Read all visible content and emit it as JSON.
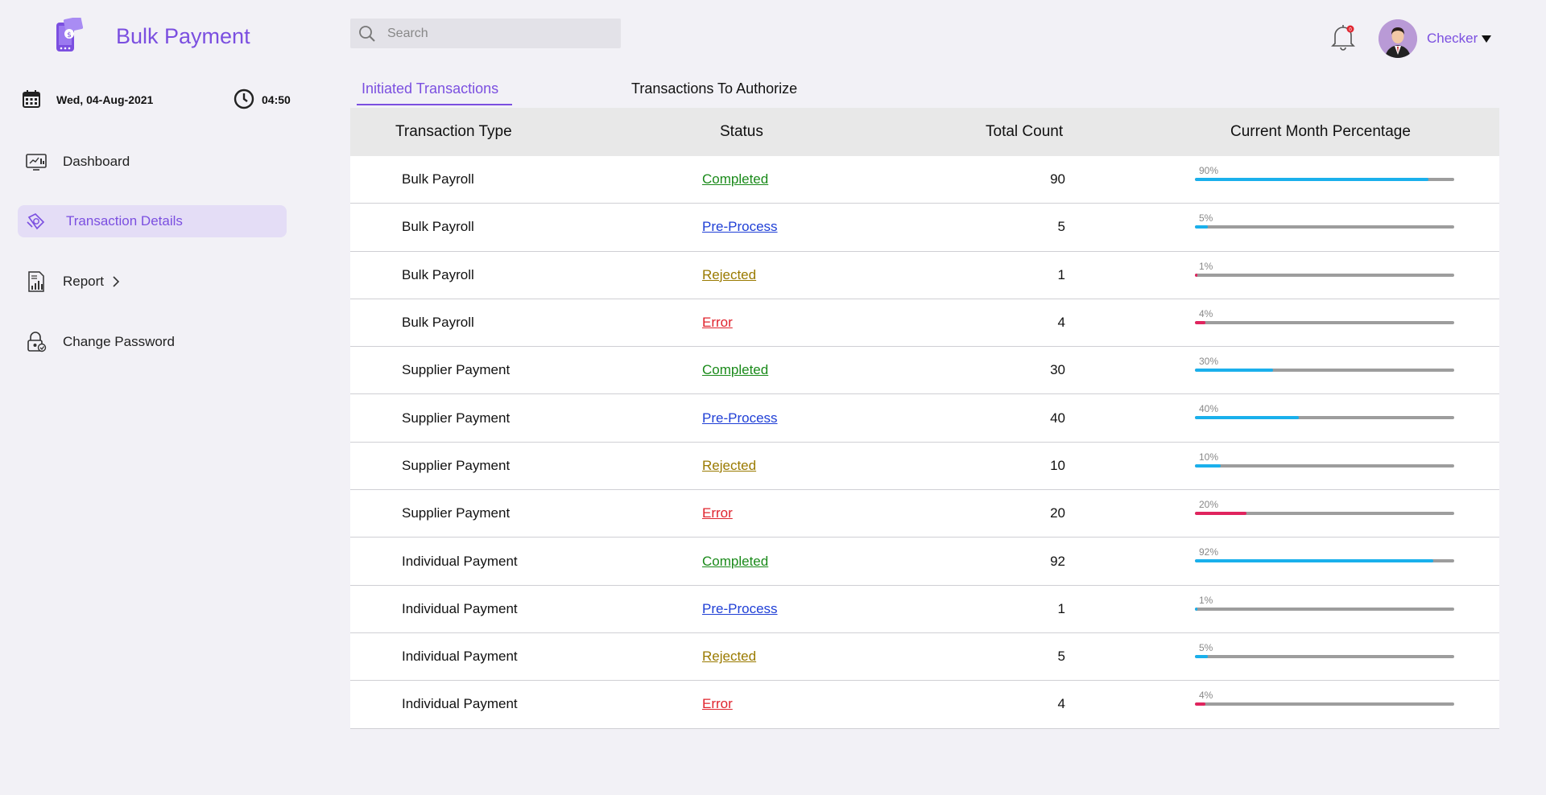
{
  "app": {
    "title": "Bulk Payment"
  },
  "datetime": {
    "date": "Wed, 04-Aug-2021",
    "time": "04:50"
  },
  "sidebar": {
    "items": [
      {
        "label": "Dashboard",
        "icon": "dashboard-monitor-icon"
      },
      {
        "label": "Transaction Details",
        "icon": "transaction-icon",
        "active": true
      },
      {
        "label": "Report",
        "icon": "report-chart-icon"
      },
      {
        "label": "Change Password",
        "icon": "password-lock-icon"
      }
    ]
  },
  "header": {
    "search_placeholder": "Search",
    "notification_count": "0",
    "user_name": "Checker"
  },
  "tabs": [
    {
      "label": "Initiated Transactions",
      "active": true
    },
    {
      "label": "Transactions To Authorize",
      "active": false
    }
  ],
  "table": {
    "columns": [
      "Transaction Type",
      "Status",
      "Total Count",
      "Current Month Percentage"
    ],
    "rows": [
      {
        "type": "Bulk Payroll",
        "status": "Completed",
        "count": "90",
        "pct_label": "90%",
        "pct": 90
      },
      {
        "type": "Bulk Payroll",
        "status": "Pre-Process",
        "count": "5",
        "pct_label": "5%",
        "pct": 5
      },
      {
        "type": "Bulk Payroll",
        "status": "Rejected",
        "count": "1",
        "pct_label": "1%",
        "pct": 1
      },
      {
        "type": "Bulk Payroll",
        "status": "Error",
        "count": "4",
        "pct_label": "4%",
        "pct": 4
      },
      {
        "type": "Supplier Payment",
        "status": "Completed",
        "count": "30",
        "pct_label": "30%",
        "pct": 30
      },
      {
        "type": "Supplier Payment",
        "status": "Pre-Process",
        "count": "40",
        "pct_label": "40%",
        "pct": 40
      },
      {
        "type": "Supplier Payment",
        "status": "Rejected",
        "count": "10",
        "pct_label": "10%",
        "pct": 10
      },
      {
        "type": "Supplier Payment",
        "status": "Error",
        "count": "20",
        "pct_label": "20%",
        "pct": 20
      },
      {
        "type": "Individual Payment",
        "status": "Completed",
        "count": "92",
        "pct_label": "92%",
        "pct": 92
      },
      {
        "type": "Individual Payment",
        "status": "Pre-Process",
        "count": "1",
        "pct_label": "1%",
        "pct": 1
      },
      {
        "type": "Individual Payment",
        "status": "Rejected",
        "count": "5",
        "pct_label": "5%",
        "pct": 5
      },
      {
        "type": "Individual Payment",
        "status": "Error",
        "count": "4",
        "pct_label": "4%",
        "pct": 4
      }
    ]
  },
  "colors": {
    "accent": "#7b4fe0",
    "status_completed": "#1a8a1a",
    "status_preprocess": "#1f3fd6",
    "status_rejected": "#9a7a00",
    "status_error": "#e0242e",
    "bar_fill": "#1ab0ec",
    "bar_fill_low": "#e0245e",
    "bar_track": "#9d9d9d"
  }
}
